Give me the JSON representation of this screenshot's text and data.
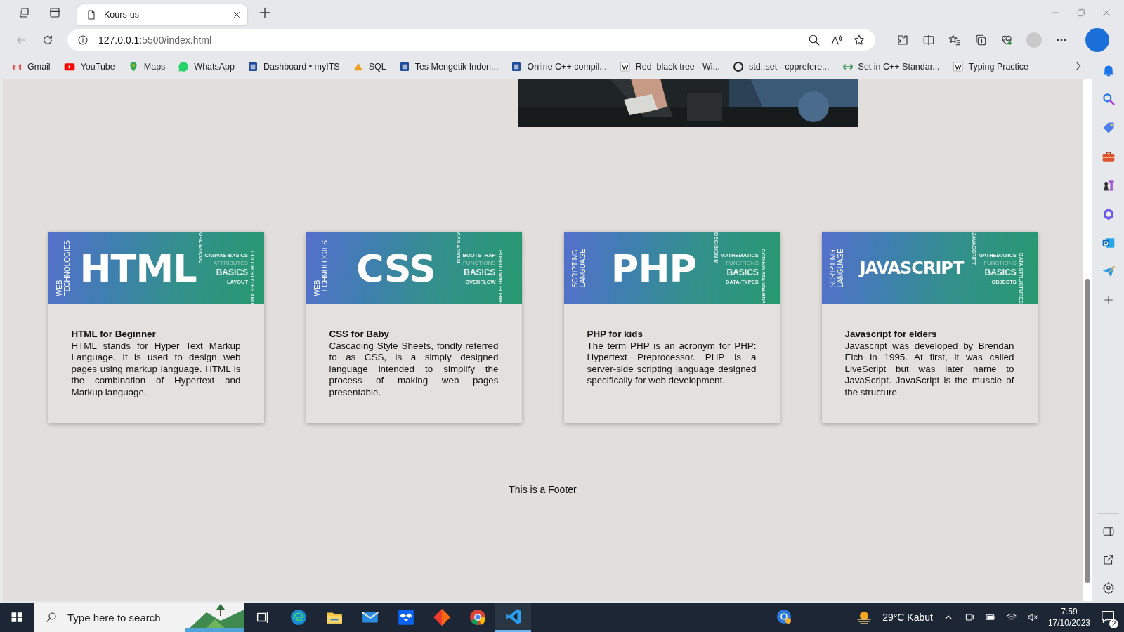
{
  "browser": {
    "tabs": [
      {
        "title": "Kours-us",
        "selected": true
      }
    ],
    "address": {
      "host": "127.0.0.1",
      "rest": ":5500/index.html"
    },
    "bookmarks": [
      {
        "label": "Gmail",
        "kind": "gmail"
      },
      {
        "label": "YouTube",
        "kind": "youtube"
      },
      {
        "label": "Maps",
        "kind": "maps"
      },
      {
        "label": "WhatsApp",
        "kind": "whatsapp"
      },
      {
        "label": "Dashboard • myITS",
        "kind": "square"
      },
      {
        "label": "SQL",
        "kind": "triangle"
      },
      {
        "label": "Tes Mengetik Indon...",
        "kind": "square"
      },
      {
        "label": "Online C++ compil...",
        "kind": "square"
      },
      {
        "label": "Red–black tree - Wi...",
        "kind": "page"
      },
      {
        "label": "std::set - cpprefere...",
        "kind": "circle"
      },
      {
        "label": "Set in C++ Standar...",
        "kind": "leaf"
      },
      {
        "label": "Typing Practice",
        "kind": "page"
      }
    ]
  },
  "page": {
    "cards": [
      {
        "title": "HTML",
        "kind": "short",
        "side_label": [
          "WEB",
          "TECHNOLOGIES"
        ],
        "vertical_words": [
          "URL ENCOD",
          "COLOR STYLES AND"
        ],
        "words": [
          {
            "text": "CANVAS BASICS",
            "faint": false
          },
          {
            "text": "ATTRIBUTES",
            "faint": true
          },
          {
            "text": "BASICS",
            "faint": false
          },
          {
            "text": "LAYOUT",
            "faint": false
          }
        ],
        "heading": "HTML for Beginner",
        "body": "HTML stands for Hyper Text Markup Language. It is used to design web pages using markup language. HTML is the combination of Hypertext and Markup language."
      },
      {
        "title": "CSS",
        "kind": "short",
        "side_label": [
          "WEB",
          "TECHNOLOGIES"
        ],
        "vertical_words": [
          "CSS ADVAN",
          "POSITIONING ELEME"
        ],
        "words": [
          {
            "text": "BOOTSTRAP",
            "faint": false
          },
          {
            "text": "FUNCTIONS",
            "faint": true
          },
          {
            "text": "BASICS",
            "faint": false
          },
          {
            "text": "OVERFLOW",
            "faint": false
          }
        ],
        "heading": "CSS for Baby",
        "body": "Cascading Style Sheets, fondly referred to as CSS, is a simply designed language intended to simplify the process of making web pages presentable."
      },
      {
        "title": "PHP",
        "kind": "short",
        "side_label": [
          "SCRIPTING",
          "LANGUAGE"
        ],
        "vertical_words": [
          "DECISION M",
          "CODING STANDARDS"
        ],
        "words": [
          {
            "text": "MATHEMATICS",
            "faint": false
          },
          {
            "text": "FUNCTIONS",
            "faint": true
          },
          {
            "text": "BASICS",
            "faint": false
          },
          {
            "text": "DATA-TYPES",
            "faint": false
          }
        ],
        "heading": "PHP for kids",
        "body": "The term PHP is an acronym for PHP: Hypertext Preprocessor. PHP is a server-side scripting language designed specifically for web development."
      },
      {
        "title": "JAVASCRIPT",
        "kind": "long",
        "side_label": [
          "SCRIPTING",
          "LANGUAGE"
        ],
        "vertical_words": [
          "JAVASCRIPT",
          "DATA STRUCTURES"
        ],
        "words": [
          {
            "text": "MATHEMATICS",
            "faint": false
          },
          {
            "text": "FUNCTIONS",
            "faint": true
          },
          {
            "text": "BASICS",
            "faint": false
          },
          {
            "text": "OBJECTS",
            "faint": false
          }
        ],
        "heading": "Javascript for elders",
        "body": "Javascript was developed by Brendan Eich in 1995. At first, it was called LiveScript but was later name to JavaScript. JavaScript is the muscle of the structure"
      }
    ],
    "footer": "This is a Footer"
  },
  "taskbar": {
    "search_placeholder": "Type here to search",
    "apps": [
      {
        "kind": "taskview",
        "selected": false
      },
      {
        "kind": "edge",
        "selected": false
      },
      {
        "kind": "folder",
        "selected": false
      },
      {
        "kind": "mail",
        "selected": false
      },
      {
        "kind": "box",
        "selected": false
      },
      {
        "kind": "diamond",
        "selected": false
      },
      {
        "kind": "chrome",
        "selected": false
      },
      {
        "kind": "code",
        "selected": true
      }
    ],
    "weather": "29°C Kabut",
    "time": "7:59",
    "date": "17/10/2023",
    "notifications": "2"
  }
}
